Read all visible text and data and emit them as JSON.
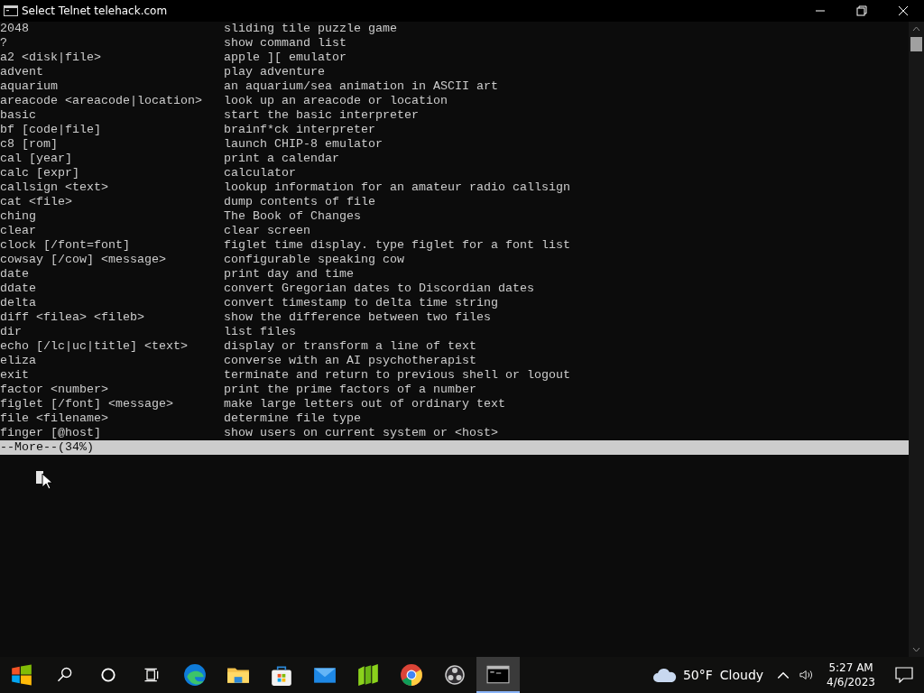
{
  "window": {
    "title": "Select Telnet telehack.com"
  },
  "lines": [
    {
      "command": "2048",
      "description": "sliding tile puzzle game"
    },
    {
      "command": "?",
      "description": "show command list"
    },
    {
      "command": "a2 <disk|file>",
      "description": "apple ][ emulator"
    },
    {
      "command": "advent",
      "description": "play adventure"
    },
    {
      "command": "aquarium",
      "description": "an aquarium/sea animation in ASCII art"
    },
    {
      "command": "areacode <areacode|location>",
      "description": "look up an areacode or location"
    },
    {
      "command": "basic",
      "description": "start the basic interpreter"
    },
    {
      "command": "bf [code|file]",
      "description": "brainf*ck interpreter"
    },
    {
      "command": "c8 [rom]",
      "description": "launch CHIP-8 emulator"
    },
    {
      "command": "cal [year]",
      "description": "print a calendar"
    },
    {
      "command": "calc [expr]",
      "description": "calculator"
    },
    {
      "command": "callsign <text>",
      "description": "lookup information for an amateur radio callsign"
    },
    {
      "command": "cat <file>",
      "description": "dump contents of file"
    },
    {
      "command": "ching",
      "description": "The Book of Changes"
    },
    {
      "command": "clear",
      "description": "clear screen"
    },
    {
      "command": "clock [/font=font]",
      "description": "figlet time display. type figlet for a font list"
    },
    {
      "command": "cowsay [/cow] <message>",
      "description": "configurable speaking cow"
    },
    {
      "command": "date",
      "description": "print day and time"
    },
    {
      "command": "ddate",
      "description": "convert Gregorian dates to Discordian dates"
    },
    {
      "command": "delta",
      "description": "convert timestamp to delta time string"
    },
    {
      "command": "diff <filea> <fileb>",
      "description": "show the difference between two files"
    },
    {
      "command": "dir",
      "description": "list files"
    },
    {
      "command": "echo [/lc|uc|title] <text>",
      "description": "display or transform a line of text"
    },
    {
      "command": "eliza",
      "description": "converse with an AI psychotherapist"
    },
    {
      "command": "exit",
      "description": "terminate and return to previous shell or logout"
    },
    {
      "command": "factor <number>",
      "description": "print the prime factors of a number"
    },
    {
      "command": "figlet [/font] <message>",
      "description": "make large letters out of ordinary text"
    },
    {
      "command": "file <filename>",
      "description": "determine file type"
    },
    {
      "command": "finger [@host]",
      "description": "show users on current system or <host>"
    }
  ],
  "more_prompt": "--More--(34%)",
  "taskbar": {
    "apps": [
      {
        "kind": "start",
        "selected": false
      },
      {
        "kind": "search",
        "selected": false
      },
      {
        "kind": "cortana",
        "selected": false
      },
      {
        "kind": "taskview",
        "selected": false
      },
      {
        "kind": "edge",
        "selected": false
      },
      {
        "kind": "folder",
        "selected": false
      },
      {
        "kind": "store",
        "selected": false
      },
      {
        "kind": "mail",
        "selected": false
      },
      {
        "kind": "green",
        "selected": false
      },
      {
        "kind": "chrome",
        "selected": false
      },
      {
        "kind": "obs",
        "selected": false
      },
      {
        "kind": "terminal",
        "selected": true
      }
    ],
    "weather": {
      "temperature": "50°F",
      "condition": "Cloudy"
    },
    "time": "5:27 AM",
    "date": "4/6/2023"
  }
}
